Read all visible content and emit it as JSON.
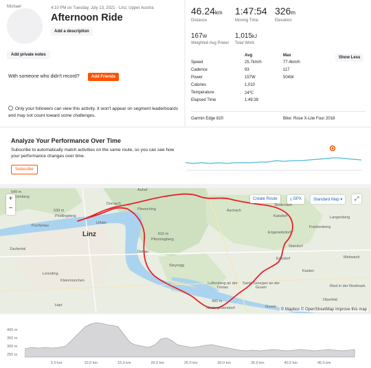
{
  "athlete": {
    "name": "Michael"
  },
  "activity": {
    "meta": "4:10 PM on Tuesday, July 13, 2021 · Linz, Upper Austria",
    "title": "Afternoon Ride",
    "add_description": "Add a description",
    "add_private_notes": "Add private notes",
    "no_record_text": "With someone who didn't record?",
    "add_friends": "Add Friends",
    "privacy_note": "Only your followers can view this activity. It won't appear on segment leaderboards and may not count toward some challenges."
  },
  "stats": {
    "primary": [
      {
        "value": "46.24",
        "unit": "km",
        "label": "Distance"
      },
      {
        "value": "1:47:54",
        "unit": "",
        "label": "Moving Time"
      },
      {
        "value": "326",
        "unit": "m",
        "label": "Elevation"
      }
    ],
    "secondary": [
      {
        "value": "167",
        "unit": "W",
        "label": "Weighted Avg Power"
      },
      {
        "value": "1,015",
        "unit": "kJ",
        "label": "Total Work"
      }
    ],
    "show_less": "Show Less",
    "table_headers": {
      "avg": "Avg",
      "max": "Max"
    },
    "table_rows": [
      {
        "label": "Speed",
        "avg": "25.7km/h",
        "max": "77.4km/h"
      },
      {
        "label": "Cadence",
        "avg": "93",
        "max": "117"
      },
      {
        "label": "Power",
        "avg": "157W",
        "max": "504W"
      },
      {
        "label": "Calories",
        "avg": "1,010",
        "max": ""
      },
      {
        "label": "Temperature",
        "avg": "24℃",
        "max": ""
      },
      {
        "label": "Elapsed Time",
        "avg": "1:49:39",
        "max": ""
      }
    ],
    "device": "Garmin Edge 820",
    "bike": "Bike: Rose X-Lite Four 2018"
  },
  "performance": {
    "title": "Analyze Your Performance Over Time",
    "text": "Subscribe to automatically match activities on the same route, so you can see how your performance changes over time.",
    "subscribe": "Subscribe",
    "accent_color": "#fc5200",
    "line_color": "#4bb8d9"
  },
  "map": {
    "create_route": "Create Route",
    "gpx": "GPX",
    "map_type": "Standard Map",
    "zoom_in": "+",
    "zoom_out": "−",
    "attribution": "© Mapbox © OpenStreetMap Improve this map",
    "route_color": "#e8202a",
    "labels": [
      "549 m",
      "Kürnberg",
      "Puchenau",
      "Pöstlingberg",
      "539 m",
      "Linz",
      "Urfahr",
      "Dornach",
      "Auhof",
      "Steyregg",
      "Donau",
      "Pfenningberg",
      "616 m",
      "Pleesching",
      "Luftenberg an der Donau",
      "Sankt Georgen an der Gusen",
      "Gusen",
      "Katsdorf",
      "Engerwitzdorf",
      "Langenberg",
      "Ried in der Riedmark",
      "Leonding",
      "Kleinmünchen",
      "Hart",
      "Zaubertal",
      "Bodendorf",
      "Standorf",
      "Edlsdorf",
      "Mahwach",
      "Frankenberg",
      "Kasten",
      "Oberfeld",
      "400 m",
      "Niedergöllersdorf",
      "Aschach"
    ]
  },
  "elevation_chart": {
    "y_ticks": [
      "400 m",
      "350 m",
      "300 m",
      "250 m"
    ],
    "x_ticks": [
      "5.0 km",
      "10.0 km",
      "15.0 km",
      "20.0 km",
      "25.0 km",
      "30.0 km",
      "35.0 km",
      "40.0 km",
      "45.0 km"
    ],
    "fill_color": "#d6d6d9",
    "line_color": "#a8a8ad"
  }
}
